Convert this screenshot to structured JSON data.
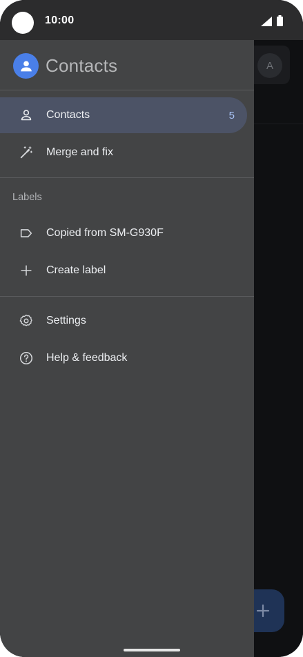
{
  "status_bar": {
    "time": "10:00"
  },
  "background": {
    "avatar_letter": "A"
  },
  "drawer": {
    "app_title": "Contacts",
    "items": [
      {
        "label": "Contacts",
        "count": "5",
        "icon": "person-icon",
        "active": true
      },
      {
        "label": "Merge and fix",
        "icon": "magic-wand-icon"
      }
    ],
    "labels_section": {
      "heading": "Labels",
      "items": [
        {
          "label": "Copied from SM-G930F",
          "icon": "label-tag-icon"
        },
        {
          "label": "Create label",
          "icon": "plus-icon"
        }
      ]
    },
    "footer_items": [
      {
        "label": "Settings",
        "icon": "gear-icon"
      },
      {
        "label": "Help & feedback",
        "icon": "help-circle-icon"
      }
    ]
  },
  "colors": {
    "drawer_bg": "#434445",
    "active_item_bg": "#4c5366",
    "accent_blue": "#4a7fe8",
    "count_color": "#a9c3f5"
  }
}
